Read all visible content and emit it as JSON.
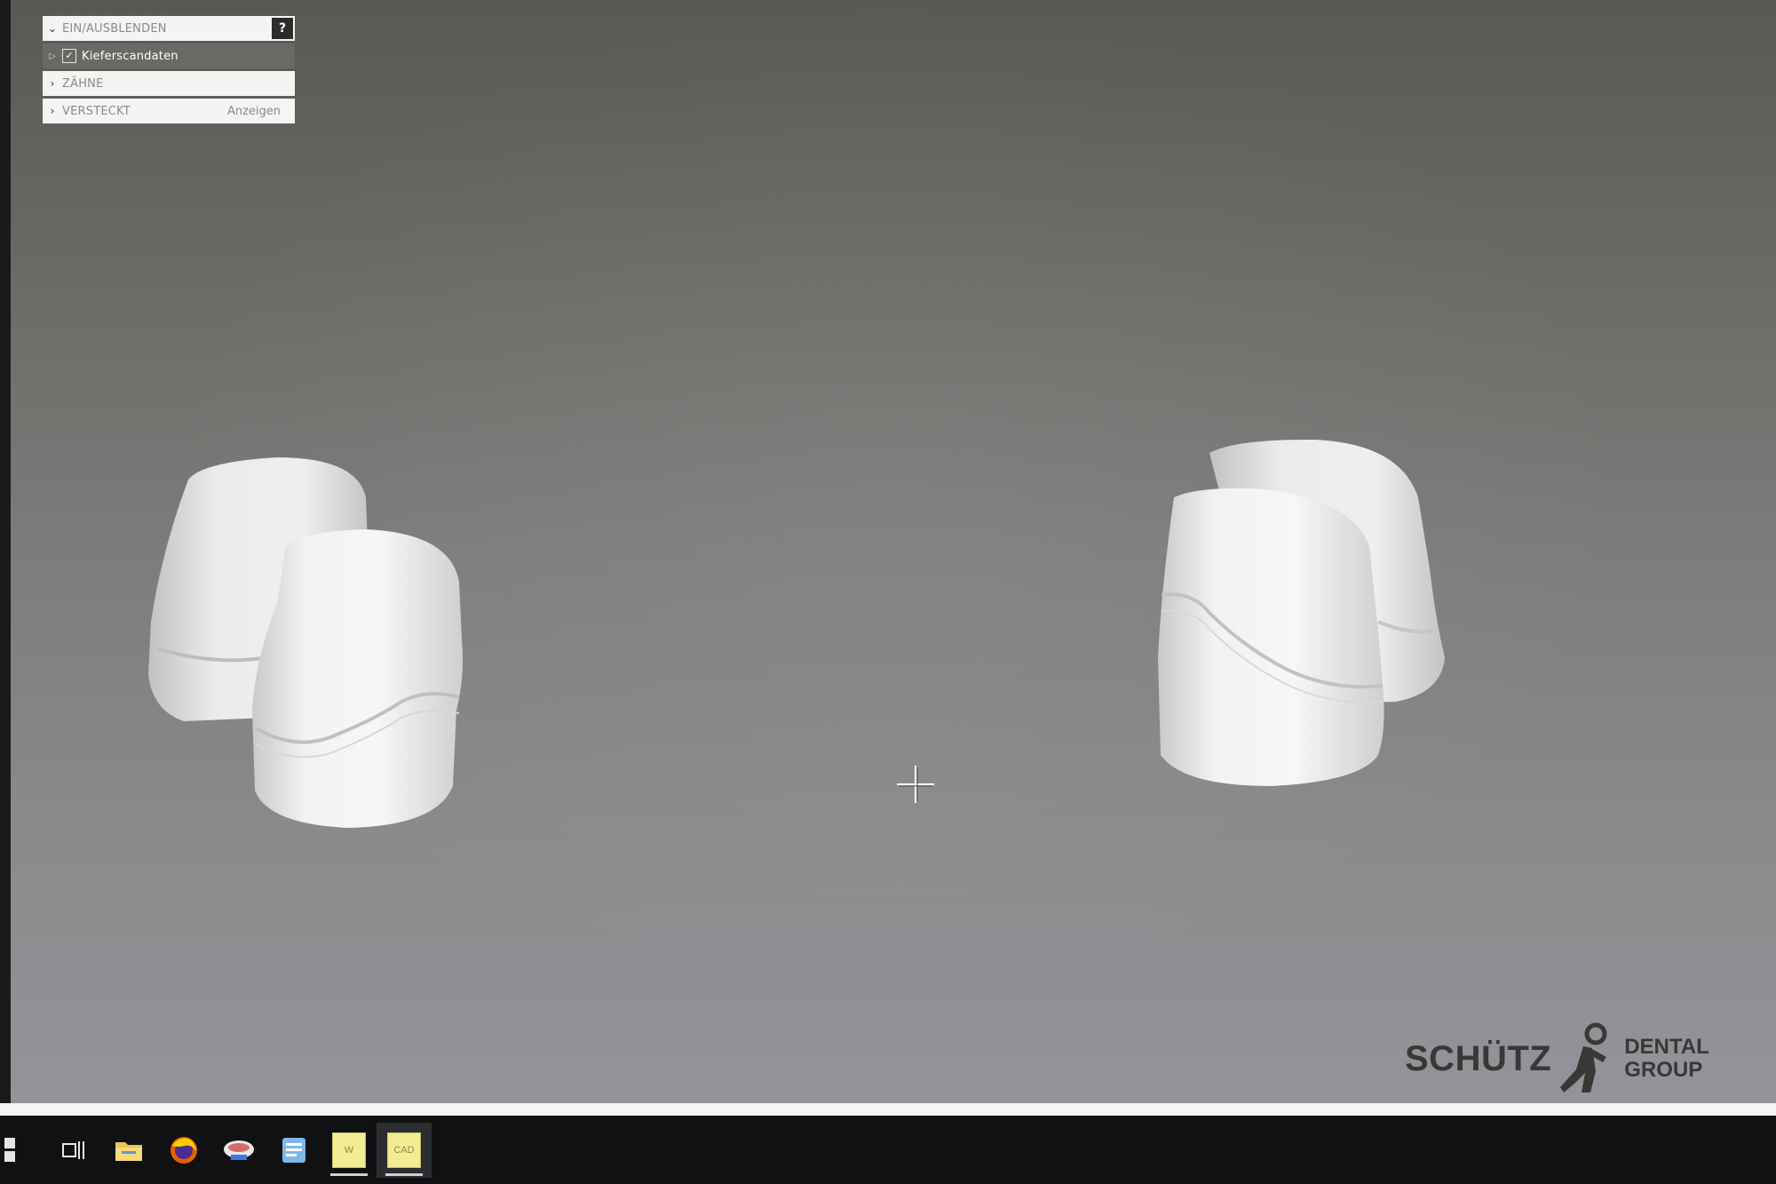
{
  "panel": {
    "header": {
      "label": "EIN/AUSBLENDEN",
      "help": "?"
    },
    "scan_row": {
      "label": "Kieferscandaten",
      "checked": true
    },
    "teeth_row": {
      "label": "ZÄHNE"
    },
    "hidden_row": {
      "label": "VERSTECKT",
      "action": "Anzeigen"
    }
  },
  "logo": {
    "name": "SCHÜTZ",
    "line1": "DENTAL",
    "line2": "GROUP"
  },
  "taskbar": {
    "items": [
      {
        "name": "start-icon"
      },
      {
        "name": "task-view-icon"
      },
      {
        "name": "file-explorer-icon"
      },
      {
        "name": "firefox-icon"
      },
      {
        "name": "dental-app-icon"
      },
      {
        "name": "document-app-icon"
      },
      {
        "name": "w-app-icon",
        "label": "W"
      },
      {
        "name": "cad-app-icon",
        "label": "CAD"
      }
    ]
  },
  "colors": {
    "viewport_top": "#5a5853",
    "viewport_bottom": "#93939a",
    "die": "#efefef",
    "panel_header": "#f4f4f4",
    "panel_selected": "#6b6964",
    "taskbar": "#101113"
  }
}
